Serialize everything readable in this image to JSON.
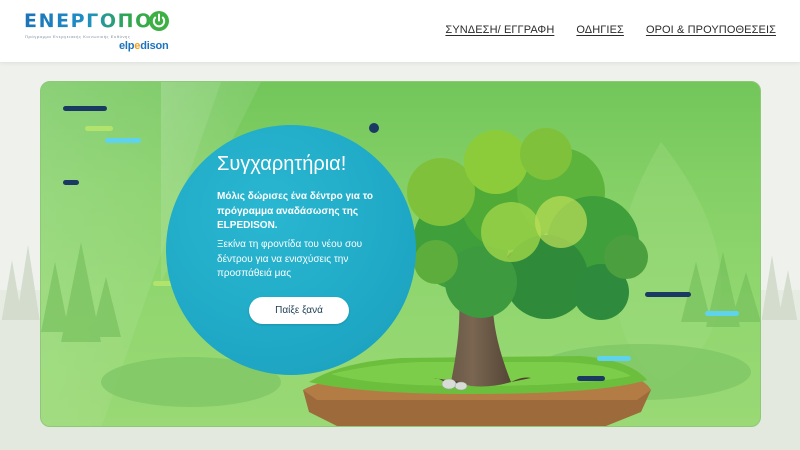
{
  "header": {
    "logo": {
      "title": "ΕΝΕΡΓΟΠΟΙ",
      "tagline": "Πρόγραμμα Ενεργειακής Κοινωνικής Ευθύνης",
      "brand_start": "elp",
      "brand_dot": "e",
      "brand_end": "dison"
    },
    "nav": [
      {
        "label": "ΣΥΝΔΕΣΗ/ ΕΓΓΡΑΦΗ"
      },
      {
        "label": "ΟΔΗΓΙΕΣ"
      },
      {
        "label": "ΟΡΟΙ & ΠΡΟΥΠΟΘΕΣΕΙΣ"
      }
    ]
  },
  "main": {
    "headline": "Συγχαρητήρια!",
    "message": "Μόλις δώρισες ένα δέντρο για το πρόγραμμα αναδάσωσης της ELPEDISON.",
    "submessage": "Ξεκίνα τη φροντίδα του νέου σου δέντρου για να ενισχύσεις την προσπάθειά μας",
    "play_again_label": "Παίξε ξανά"
  },
  "colors": {
    "card_green": "#84d066",
    "circle_teal": "#1fa9c6",
    "dash_navy": "#1b3a63",
    "dash_cyan": "#5fd3ee",
    "dash_lime": "#b2e36c",
    "brand_blue": "#1d74bb",
    "brand_green": "#3cb043"
  },
  "icons": {
    "power": "power-icon",
    "tree": "tree-illustration",
    "island": "floating-island"
  }
}
